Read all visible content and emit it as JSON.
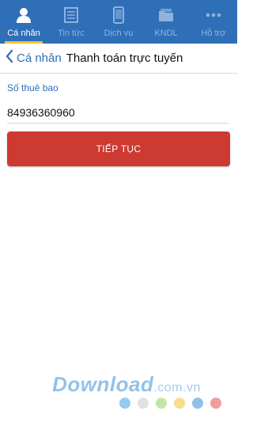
{
  "tabs": [
    {
      "label": "Cá nhân",
      "icon": "person-icon",
      "active": true
    },
    {
      "label": "Tin tức",
      "icon": "news-icon",
      "active": false
    },
    {
      "label": "Dịch vụ",
      "icon": "phone-icon",
      "active": false
    },
    {
      "label": "KNDL",
      "icon": "folder-icon",
      "active": false
    },
    {
      "label": "Hỗ trợ",
      "icon": "more-icon",
      "active": false
    }
  ],
  "navbar": {
    "back_label": "Cá nhân",
    "title": "Thanh toán trực tuyến"
  },
  "form": {
    "field_label": "Số thuê bao",
    "phone_value": "84936360960",
    "continue_label": "TIẾP TỤC"
  },
  "watermark": {
    "brand": "Download",
    "suffix": ".com.vn",
    "dot_colors": [
      "#3aa0e8",
      "#c8c8c8",
      "#8fd35a",
      "#f2c230",
      "#3a8ad8",
      "#e84a4a"
    ]
  },
  "colors": {
    "tabbar_bg": "#2f6fb8",
    "active_underline": "#f2c230",
    "button_bg": "#cc3a32",
    "accent": "#2f6fb8"
  }
}
